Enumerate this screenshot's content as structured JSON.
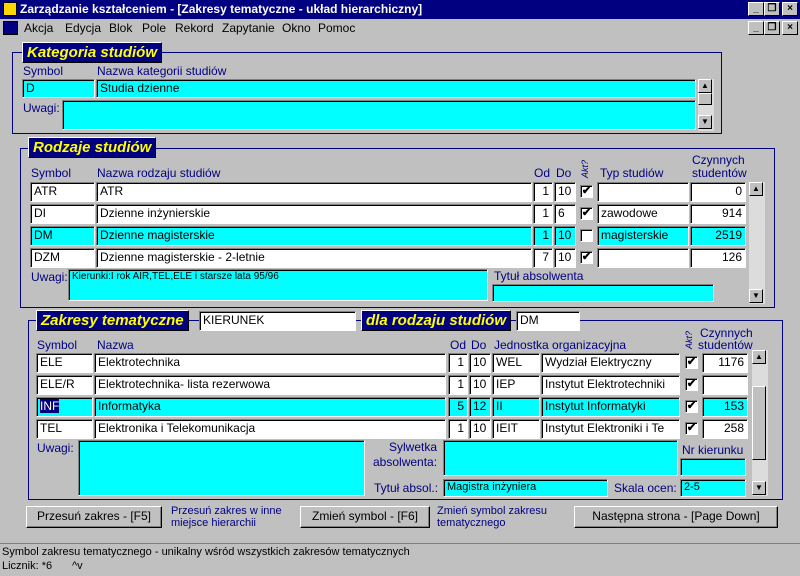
{
  "window": {
    "title": "Zarządzanie kształceniem - [Zakresy tematyczne - układ hierarchiczny]"
  },
  "menu": [
    "Akcja",
    "Edycja",
    "Blok",
    "Pole",
    "Rekord",
    "Zapytanie",
    "Okno",
    "Pomoc"
  ],
  "kategoria": {
    "title": "Kategoria studiów",
    "col_symbol": "Symbol",
    "col_name": "Nazwa kategorii studiów",
    "symbol": "D",
    "name": "Studia dzienne",
    "uwagi_label": "Uwagi:",
    "uwagi": ""
  },
  "rodzaje": {
    "title": "Rodzaje studiów",
    "headers": {
      "symbol": "Symbol",
      "name": "Nazwa rodzaju studiów",
      "od": "Od",
      "do": "Do",
      "akt": "Akt?",
      "typ": "Typ studiów",
      "czynnych1": "Czynnych",
      "czynnych2": "studentów"
    },
    "rows": [
      {
        "symbol": "ATR",
        "name": "ATR",
        "od": "1",
        "do": "10",
        "akt": "✔",
        "typ": "",
        "czynnych": "0"
      },
      {
        "symbol": "DI",
        "name": "Dzienne inżynierskie",
        "od": "1",
        "do": "6",
        "akt": "✔",
        "typ": "zawodowe",
        "czynnych": "914"
      },
      {
        "symbol": "DM",
        "name": "Dzienne magisterskie",
        "od": "1",
        "do": "10",
        "akt": "",
        "typ": "magisterskie",
        "czynnych": "2519"
      },
      {
        "symbol": "DZM",
        "name": "Dzienne  magisterskie -  2-letnie",
        "od": "7",
        "do": "10",
        "akt": "✔",
        "typ": "",
        "czynnych": "126"
      }
    ],
    "uwagi_label": "Uwagi:",
    "uwagi": "Kierunki:I rok  AIR,TEL,ELE i starsze lata 95/96",
    "tytul_label": "Tytuł absolwenta",
    "tytul": ""
  },
  "zakresy": {
    "title": "Zakresy tematyczne",
    "kierunek": "KIERUNEK",
    "dla_label": "dla rodzaju studiów",
    "rodzaj": "DM",
    "headers": {
      "symbol": "Symbol",
      "name": "Nazwa",
      "od": "Od",
      "do": "Do",
      "jedn": "Jednostka organizacyjna",
      "akt": "Akt?",
      "czynnych1": "Czynnych",
      "czynnych2": "studentów"
    },
    "rows": [
      {
        "symbol": "ELE",
        "name": "Elektrotechnika",
        "od": "1",
        "do": "10",
        "jcode": "WEL",
        "jname": "Wydział Elektryczny",
        "akt": "✔",
        "czynnych": "1176"
      },
      {
        "symbol": "ELE/R",
        "name": "Elektrotechnika- lista rezerwowa",
        "od": "1",
        "do": "10",
        "jcode": "IEP",
        "jname": "Instytut Elektrotechniki",
        "akt": "✔",
        "czynnych": ""
      },
      {
        "symbol": "INF",
        "name": "Informatyka",
        "od": "5",
        "do": "12",
        "jcode": "II",
        "jname": "Instytut Informatyki",
        "akt": "✔",
        "czynnych": "153"
      },
      {
        "symbol": "TEL",
        "name": "Elektronika i Telekomunikacja",
        "od": "1",
        "do": "10",
        "jcode": "IEIT",
        "jname": "Instytut Elektroniki i Te",
        "akt": "✔",
        "czynnych": "258"
      }
    ],
    "uwagi_label": "Uwagi:",
    "uwagi": "",
    "sylwetka_label1": "Sylwetka",
    "sylwetka_label2": "absolwenta:",
    "sylwetka": "",
    "nr_kierunku_label": "Nr kierunku",
    "nr_kierunku": "",
    "tytul_label": "Tytuł absol.:",
    "tytul": "Magistra inżyniera",
    "skala_label": "Skala ocen:",
    "skala": "2-5"
  },
  "buttons": {
    "przesun": "Przesuń zakres - [F5]",
    "przesun_hint1": "Przesuń zakres w inne",
    "przesun_hint2": "miejsce hierarchii",
    "zmien": "Zmień symbol - [F6]",
    "zmien_hint1": "Zmień symbol zakresu",
    "zmien_hint2": "tematycznego",
    "nastepna": "Następna strona - [Page Down]"
  },
  "status": {
    "line1": "Symbol zakresu tematycznego - unikalny wśród wszystkich zakresów tematycznych",
    "line2": "Licznik: *6",
    "line2b": "^v"
  }
}
